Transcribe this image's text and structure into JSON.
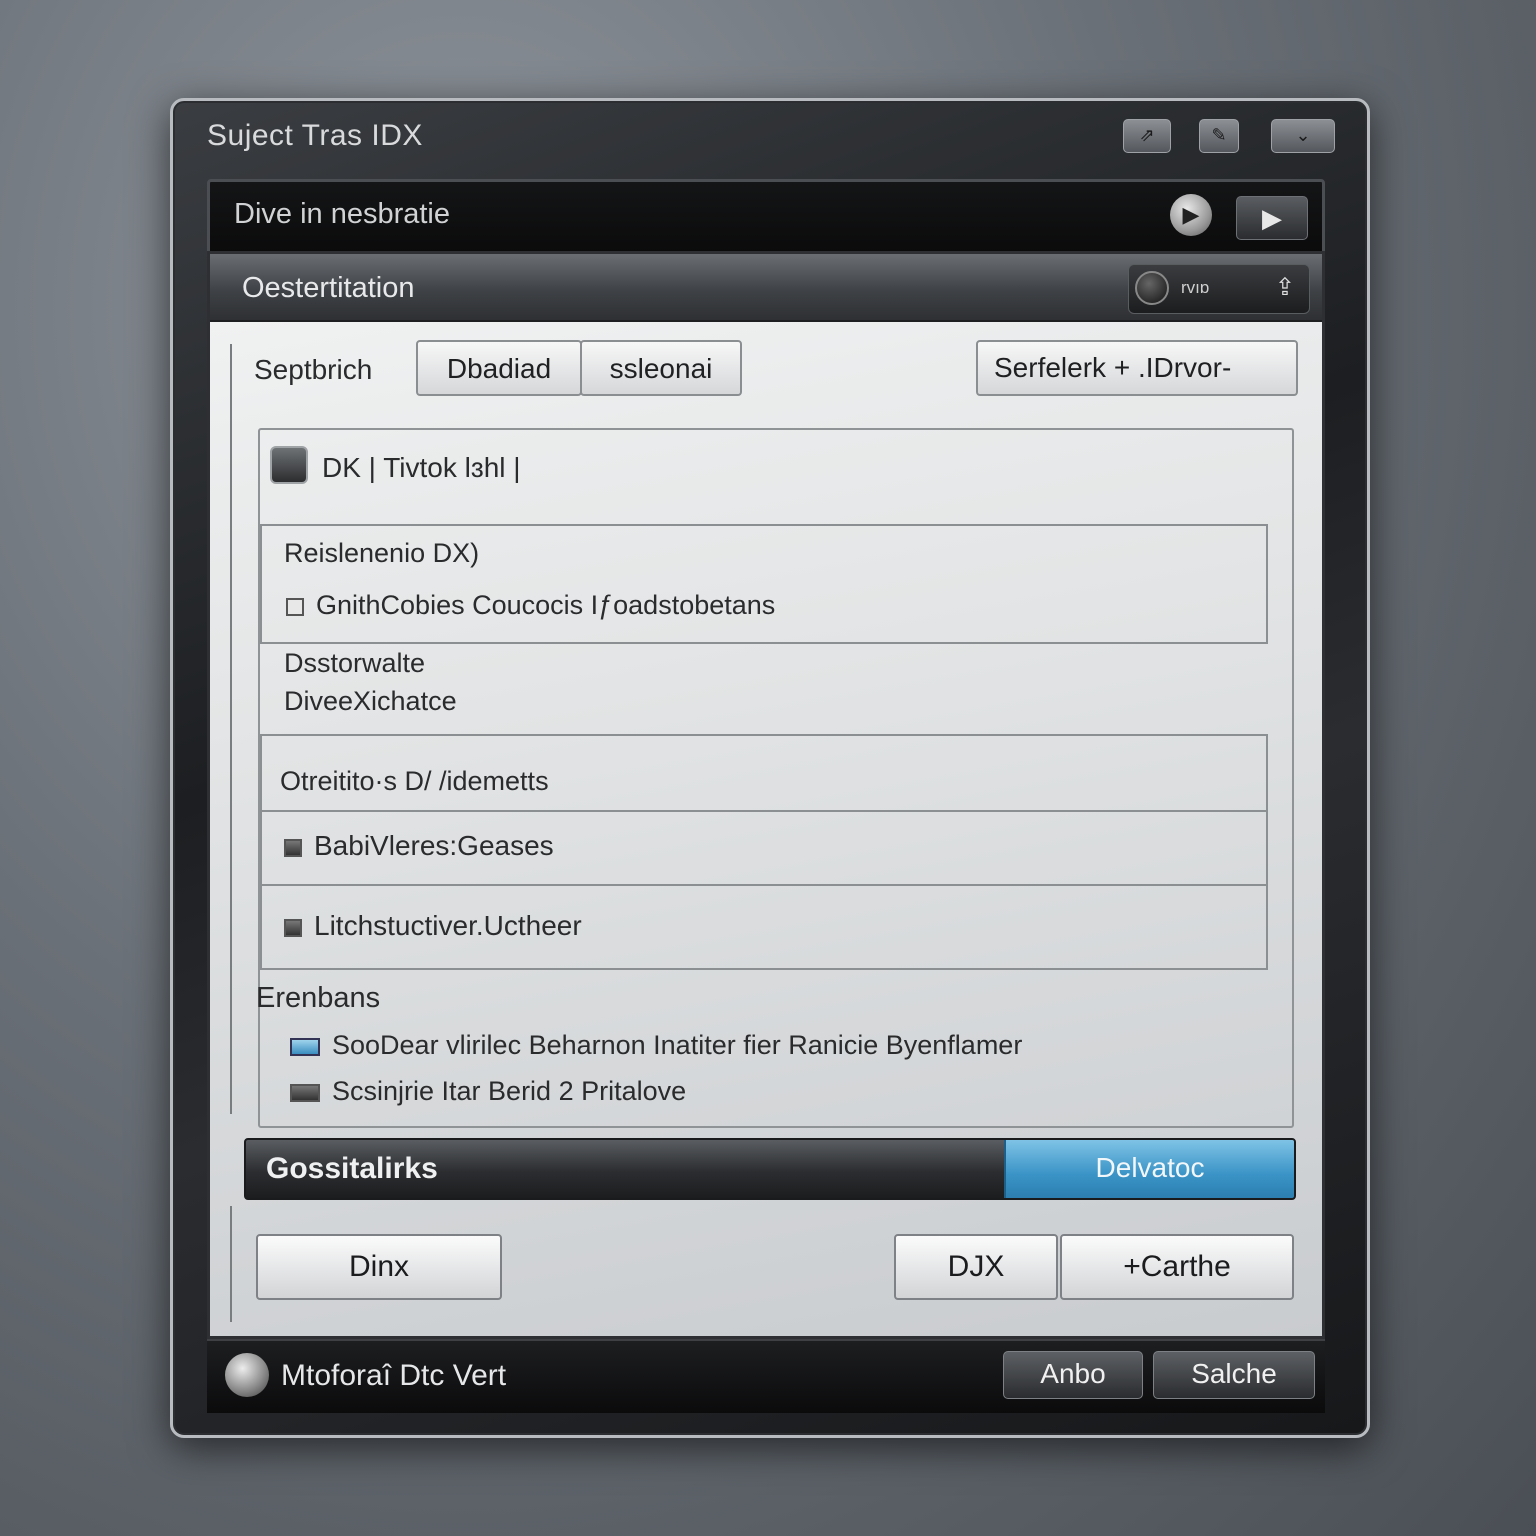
{
  "window": {
    "title": "Suject Tras IDX",
    "buttons": [
      "⇗",
      "✎",
      "⌄"
    ]
  },
  "toolbar": {
    "text": "Dive in nesbratie",
    "play_round": "▶",
    "play_rect": "▶"
  },
  "panel": {
    "title": "Oestertitation",
    "header_ctrl_text": "rvıɒ",
    "header_ctrl_icon": "⇪"
  },
  "options": {
    "label": "Septbrich",
    "segment_left": "Dbadiad",
    "segment_right": "ssleonai",
    "dropdown": "Serfelerk + .IDrvor-"
  },
  "tab": {
    "label": "DK  |  Tivtok lɜhl  |"
  },
  "section1": {
    "heading": "Reislenenio DX)",
    "item": "GnithCobies Coucocis Iƒoadstobetans"
  },
  "section2": {
    "line1": "Dsstorwalte",
    "line2": "DiveeXichatce"
  },
  "section3": {
    "heading": "Otreitito·s D/ /idemetts",
    "row1": "BabiVleres:Geases",
    "row2": "Litchstuctiver.Uctheer"
  },
  "section4": {
    "heading": "Erenbans",
    "item1": "SooDear vlirilec Beharnon Inatiter fier Ranicie Byenflamer",
    "item2": "Scsinjrie Itar Berid 2 Pritalove"
  },
  "progress": {
    "label": "Gossitalirks",
    "right_label": "Delvatoc",
    "value_fraction": 0.72
  },
  "buttons": {
    "left": "Dinx",
    "mid": "DJX",
    "right": "+Carthe"
  },
  "statusbar": {
    "text": "Mtoforaî Dtc Vert",
    "btn1": "Anbo",
    "btn2": "Salche"
  }
}
